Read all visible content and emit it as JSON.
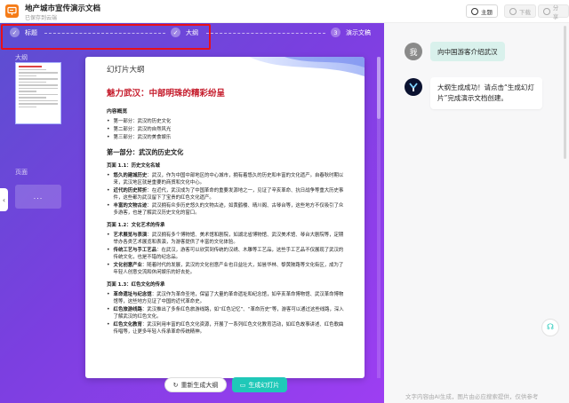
{
  "header": {
    "doc_title": "地产城市宣传演示文档",
    "doc_subtitle": "已保存到云端",
    "theme_label": "主题",
    "download_label": "下载",
    "share_label": "分享"
  },
  "steps": [
    {
      "label": "标题",
      "state": "done"
    },
    {
      "label": "大纲",
      "state": "done"
    },
    {
      "label": "演示文稿",
      "number": "3",
      "state": "current"
    }
  ],
  "left_panel": {
    "outline_label": "大纲",
    "page_label": "页面",
    "page_add": "..."
  },
  "document": {
    "card_label": "幻灯片大纲",
    "main_title": "魅力武汉：中部明珠的精彩纷呈",
    "overview_head": "内容概览",
    "overview": [
      "第一部分：武汉的历史文化",
      "第二部分：武汉的自然风光",
      "第三部分：武汉的美食娱乐"
    ],
    "part1_head": "第一部分：武汉的历史文化",
    "pages": [
      {
        "head": "页面 1.1：历史文化名城",
        "items": [
          {
            "b": "悠久的建城历史",
            "t": "：武汉，作为中国中部地区的中心城市，拥有着悠久的历史和丰富的文化遗产。自春秋时期以来，武汉地区就是重要的商贸和文化中心。"
          },
          {
            "b": "近代的历史转折",
            "t": "：在近代，武汉成为了中国革命的重要发源地之一，见证了辛亥革命、抗日战争等重大历史事件，这些都为武汉留下了宝贵的红色文化遗产。"
          },
          {
            "b": "丰富的文物古迹",
            "t": "：武汉拥有众多历史悠久的文物古迹，如黄鹤楼、晴川阁、古琴台等，这些地方不仅吸引了众多游客，也是了解武汉历史文化的窗口。"
          }
        ]
      },
      {
        "head": "页面 1.2：文化艺术的传承",
        "items": [
          {
            "b": "艺术展览与表演",
            "t": "：武汉拥有多个博物馆、美术馆和剧院，如湖北省博物馆、武汉美术馆、琴台大剧院等，定期举办各类艺术展览和表演，为游客提供了丰富的文化体验。"
          },
          {
            "b": "传统工艺与手工艺品",
            "t": "：在武汉，游客可以欣赏到传统的汉绣、木雕等工艺品，这些手工艺品不仅展现了武汉的传统文化，也是不错的纪念品。"
          },
          {
            "b": "文化创意产业",
            "t": "：随着时代的发展，武汉的文化创意产业也日益壮大，如昙华林、黎黄陂路等文化街区，成为了年轻人创意交流和休闲娱乐的好去处。"
          }
        ]
      },
      {
        "head": "页面 1.3：红色文化的传承",
        "items": [
          {
            "b": "革命遗址与纪念馆",
            "t": "：武汉作为革命圣地，保留了大量的革命遗址和纪念馆，如辛亥革命博物馆、武汉革命博物馆等，这些地方见证了中国的近代革命史。"
          },
          {
            "b": "红色旅游线路",
            "t": "：武汉推出了多条红色旅游线路，如“红色记忆”、“革命历史”等，游客可以通过这些线路，深入了解武汉的红色文化。"
          },
          {
            "b": "红色文化教育",
            "t": "：武汉利用丰富的红色文化资源，开展了一系列红色文化教育活动，如红色故事讲述、红色歌曲传唱等，让更多年轻人传承革命传统精神。"
          }
        ]
      }
    ]
  },
  "actions": {
    "regen_label": "重新生成大纲",
    "gen_label": "生成幻灯片"
  },
  "chat": {
    "user_avatar": "我",
    "user_message": "向中国游客介绍武汉",
    "bot_message": "大纲生成成功！请点击“生成幻灯片”完成演示文档创建。",
    "disclaimer": "文字内容由AI生成，图片由必应搜索提供，仅供参考"
  },
  "colors": {
    "accent": "#1fc8b8",
    "brand": "#f57c18",
    "title_red": "#c51b2b",
    "highlight": "#e8101a"
  }
}
